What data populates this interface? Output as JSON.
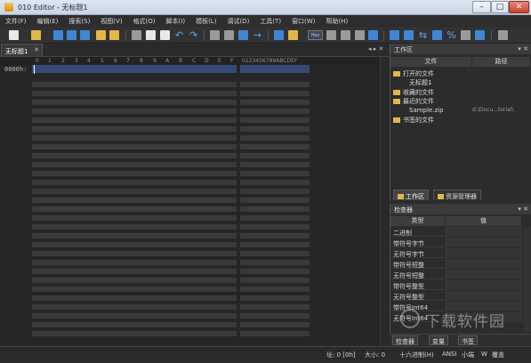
{
  "window": {
    "title": "010 Editor - 无标题1"
  },
  "menu": [
    "文件(F)",
    "编辑(E)",
    "搜索(S)",
    "视图(V)",
    "格式(O)",
    "脚本(I)",
    "模板(L)",
    "调试(D)",
    "工具(T)",
    "窗口(W)",
    "帮助(H)"
  ],
  "editor": {
    "tab_label": "无标题1",
    "hex_columns": [
      "0",
      "1",
      "2",
      "3",
      "4",
      "5",
      "6",
      "7",
      "8",
      "9",
      "A",
      "B",
      "C",
      "D",
      "E",
      "F"
    ],
    "ascii_header": "0123456789ABCDEF",
    "first_row_address": "0000h:",
    "toolbar_hex_label": "Hex"
  },
  "workspace": {
    "title": "工作区",
    "columns": {
      "file": "文件",
      "path": "路径"
    },
    "items": [
      {
        "label": "打开的文件",
        "path": ""
      },
      {
        "label": "无标题1",
        "path": ""
      },
      {
        "label": "收藏的文件",
        "path": ""
      },
      {
        "label": "最近的文件",
        "path": ""
      },
      {
        "label": "Sample.zip",
        "path": "d:\\Docu...torial\\"
      },
      {
        "label": "书签的文件",
        "path": ""
      }
    ]
  },
  "panel_tabs": {
    "workspace": "工作区",
    "explorer": "资源管理器"
  },
  "inspector": {
    "title": "检查器",
    "columns": {
      "type": "类型",
      "value": "值"
    },
    "rows": [
      "二进制",
      "带符号字节",
      "无符号字节",
      "带符号短整",
      "无符号短整",
      "带符号整型",
      "无符号整型",
      "带符号Int64",
      "无符号Int64"
    ]
  },
  "bottom_tabs": [
    "检查器",
    "变量",
    "书签"
  ],
  "status": {
    "address": "址: 0 [0h]",
    "size": "大小: 0",
    "encoding_mode": "十六进制(H)",
    "charset": "ANSI",
    "endian": "小端",
    "write_mode": "W",
    "overwrite": "覆盖"
  },
  "watermark": "下载软件园"
}
